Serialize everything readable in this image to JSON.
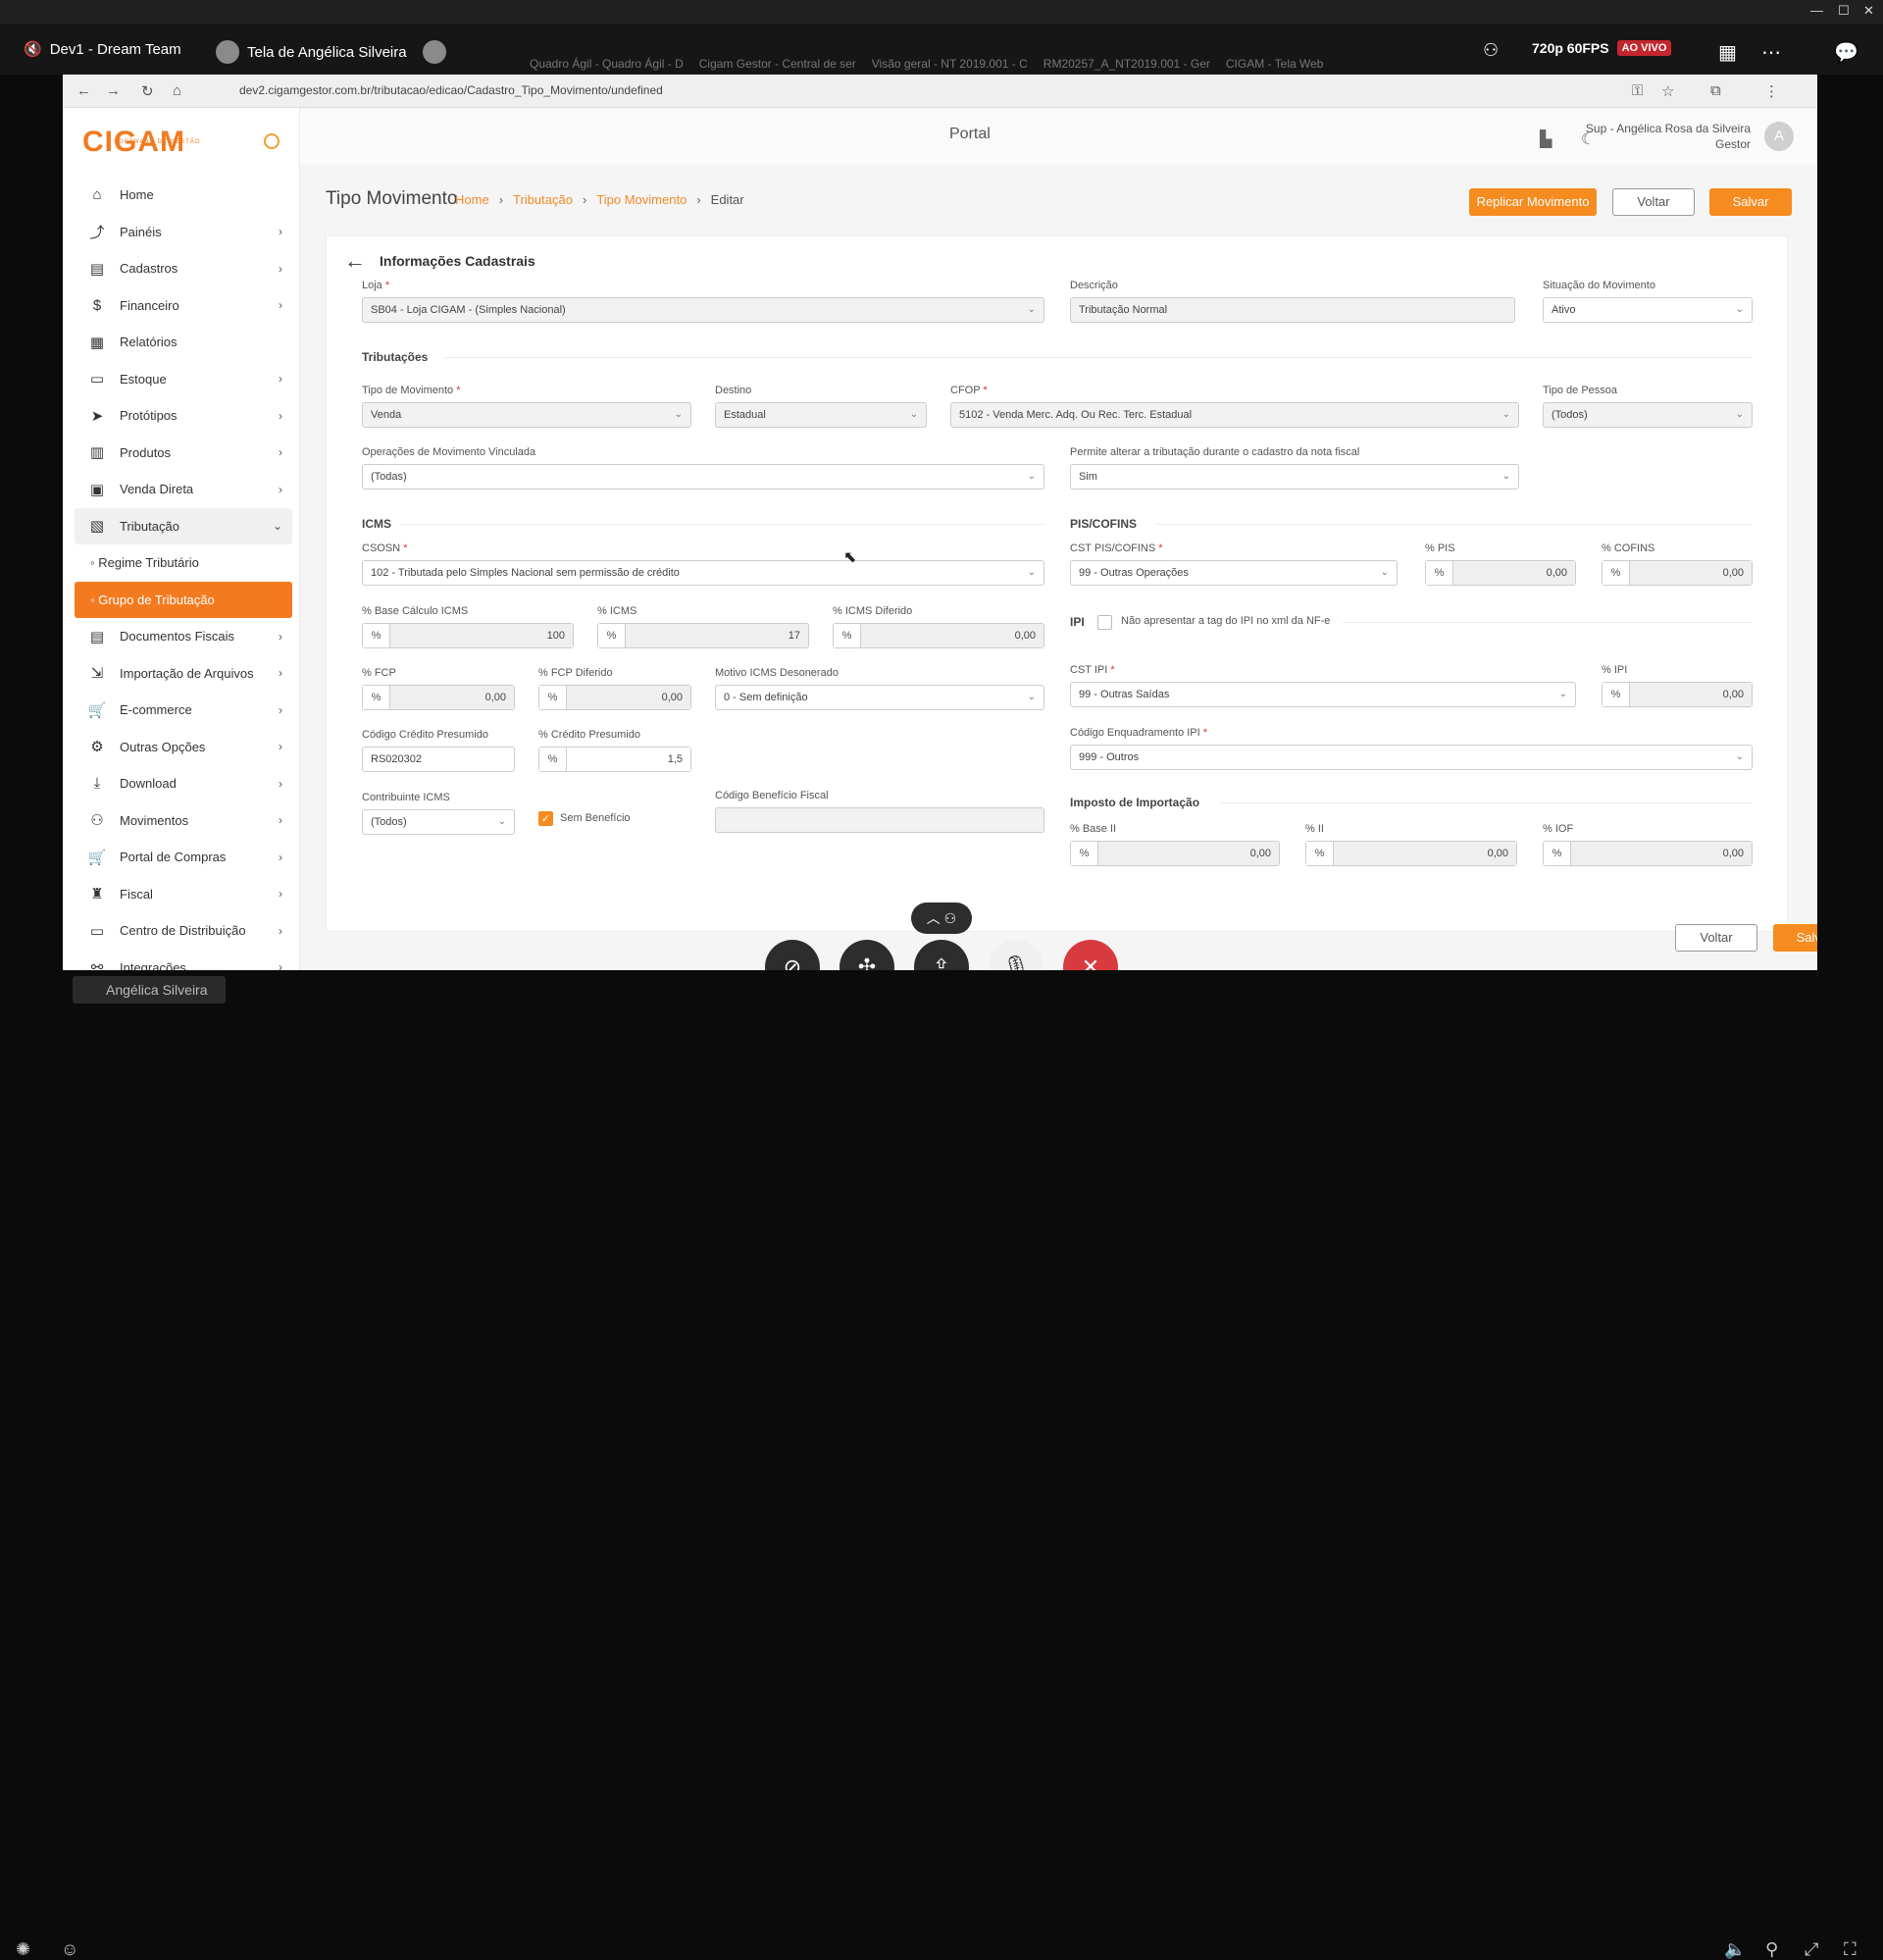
{
  "window": {
    "minimize": "—",
    "maximize": "☐",
    "close": "✕"
  },
  "meeting": {
    "title": "Dev1 - Dream Team",
    "share_title": "Tela de Angélica Silveira",
    "quality": "720p 60FPS",
    "live_badge": "AO VIVO",
    "presenter_name": "Angélica Silveira"
  },
  "browser": {
    "tabs": [
      "Quadro Ágil - Quadro Ágil - D",
      "Cigam Gestor - Central de ser",
      "Visão geral - NT 2019.001 - C",
      "RM20257_A_NT2019.001 - Ger",
      "CIGAM - Tela Web"
    ],
    "url": "dev2.cigamgestor.com.br/tributacao/edicao/Cadastro_Tipo_Movimento/undefined"
  },
  "app": {
    "logo": "CIGAM",
    "logo_sub": "SOFTWARE DE GESTÃO",
    "portal": "Portal",
    "user_name": "Sup - Angélica Rosa da Silveira",
    "user_role": "Gestor",
    "user_initial": "A"
  },
  "sidebar": {
    "items": [
      {
        "label": "Home",
        "icon": "home-icon",
        "glyph": "⌂"
      },
      {
        "label": "Painéis",
        "icon": "chart-icon",
        "glyph": "⤴",
        "chev": "›"
      },
      {
        "label": "Cadastros",
        "icon": "files-icon",
        "glyph": "▤",
        "chev": "›"
      },
      {
        "label": "Financeiro",
        "icon": "dollar-icon",
        "glyph": "$",
        "chev": "›"
      },
      {
        "label": "Relatórios",
        "icon": "report-icon",
        "glyph": "▦"
      },
      {
        "label": "Estoque",
        "icon": "box-icon",
        "glyph": "▭",
        "chev": "›"
      },
      {
        "label": "Protótipos",
        "icon": "send-icon",
        "glyph": "➤",
        "chev": "›"
      },
      {
        "label": "Produtos",
        "icon": "barcode-icon",
        "glyph": "▥",
        "chev": "›"
      },
      {
        "label": "Venda Direta",
        "icon": "register-icon",
        "glyph": "▣",
        "chev": "›"
      },
      {
        "label": "Tributação",
        "icon": "tax-icon",
        "glyph": "▧",
        "chev": "⌄"
      }
    ],
    "sub_items": [
      "Regime Tributário",
      "Grupo de Tributação"
    ],
    "items2": [
      {
        "label": "Documentos Fiscais",
        "icon": "document-icon",
        "glyph": "▤",
        "chev": "›"
      },
      {
        "label": "Importação de Arquivos",
        "icon": "import-icon",
        "glyph": "⇲",
        "chev": "›"
      },
      {
        "label": "E-commerce",
        "icon": "cart-icon",
        "glyph": "🛒",
        "chev": "›"
      },
      {
        "label": "Outras Opções",
        "icon": "gears-icon",
        "glyph": "⚙",
        "chev": "›"
      },
      {
        "label": "Download",
        "icon": "download-icon",
        "glyph": "⤓",
        "chev": "›"
      },
      {
        "label": "Movimentos",
        "icon": "people-icon",
        "glyph": "⚇",
        "chev": "›"
      },
      {
        "label": "Portal de Compras",
        "icon": "cart2-icon",
        "glyph": "🛒",
        "chev": "›"
      },
      {
        "label": "Fiscal",
        "icon": "bag-icon",
        "glyph": "♜",
        "chev": "›"
      },
      {
        "label": "Centro de Distribuição",
        "icon": "warehouse-icon",
        "glyph": "▭",
        "chev": "›"
      },
      {
        "label": "Integrações",
        "icon": "link-icon",
        "glyph": "⚯",
        "chev": "›"
      }
    ]
  },
  "page": {
    "title": "Tipo Movimento",
    "crumbs": [
      "Home",
      "Tributação",
      "Tipo Movimento",
      "Editar"
    ],
    "btn_replicar": "Replicar Movimento",
    "btn_voltar": "Voltar",
    "btn_salvar": "Salvar",
    "card_title": "Informações Cadastrais"
  },
  "form": {
    "loja_label": "Loja",
    "loja": "SB04 - Loja CIGAM - (Simples Nacional)",
    "descricao_label": "Descrição",
    "descricao": "Tributação Normal",
    "situacao_label": "Situação do Movimento",
    "situacao": "Ativo",
    "sec_trib": "Tributações",
    "tipo_mov_label": "Tipo de Movimento",
    "tipo_mov": "Venda",
    "destino_label": "Destino",
    "destino": "Estadual",
    "cfop_label": "CFOP",
    "cfop": "5102 - Venda Merc. Adq. Ou Rec. Terc. Estadual",
    "tipo_pessoa_label": "Tipo de Pessoa",
    "tipo_pessoa": "(Todos)",
    "op_vinc_label": "Operações de Movimento Vinculada",
    "op_vinc": "(Todas)",
    "permite_label": "Permite alterar a tributação durante o cadastro da nota fiscal",
    "permite": "Sim",
    "sec_icms": "ICMS",
    "csosn_label": "CSOSN",
    "csosn": "102 - Tributada pelo Simples Nacional sem permissão de crédito",
    "base_icms_label": "% Base Cálculo ICMS",
    "base_icms": "100",
    "icms_label": "% ICMS",
    "icms": "17",
    "icms_dif_label": "% ICMS Diferido",
    "icms_dif": "0,00",
    "fcp_label": "% FCP",
    "fcp": "0,00",
    "fcp_dif_label": "% FCP Diferido",
    "fcp_dif": "0,00",
    "motivo_label": "Motivo ICMS Desonerado",
    "motivo": "0 - Sem definição",
    "cod_cred_label": "Código Crédito Presumido",
    "cod_cred": "RS020302",
    "cred_pres_label": "% Crédito Presumido",
    "cred_pres": "1,5",
    "contrib_label": "Contribuinte ICMS",
    "contrib": "(Todos)",
    "sem_benef": "Sem Benefício",
    "cod_benef_label": "Código Benefício Fiscal",
    "cod_benef": "",
    "sec_pis": "PIS/COFINS",
    "cst_pis_label": "CST PIS/COFINS",
    "cst_pis": "99 - Outras Operações",
    "pis_label": "% PIS",
    "pis": "0,00",
    "cofins_label": "% COFINS",
    "cofins": "0,00",
    "sec_ipi": "IPI",
    "ipi_chk_label": "Não apresentar a tag do IPI no xml da NF-e",
    "cst_ipi_label": "CST IPI",
    "cst_ipi": "99 - Outras Saídas",
    "ipi_label": "% IPI",
    "ipi": "0,00",
    "enq_label": "Código Enquadramento IPI",
    "enq": "999 - Outros",
    "sec_imp": "Imposto de Importação",
    "base_ii_label": "% Base II",
    "base_ii": "0,00",
    "ii_label": "% II",
    "ii": "0,00",
    "iof_label": "% IOF",
    "iof": "0,00",
    "pct": "%",
    "req": "*",
    "dd": "⌄"
  },
  "footer": {
    "voltar": "Voltar",
    "salvar": "Salvar"
  }
}
